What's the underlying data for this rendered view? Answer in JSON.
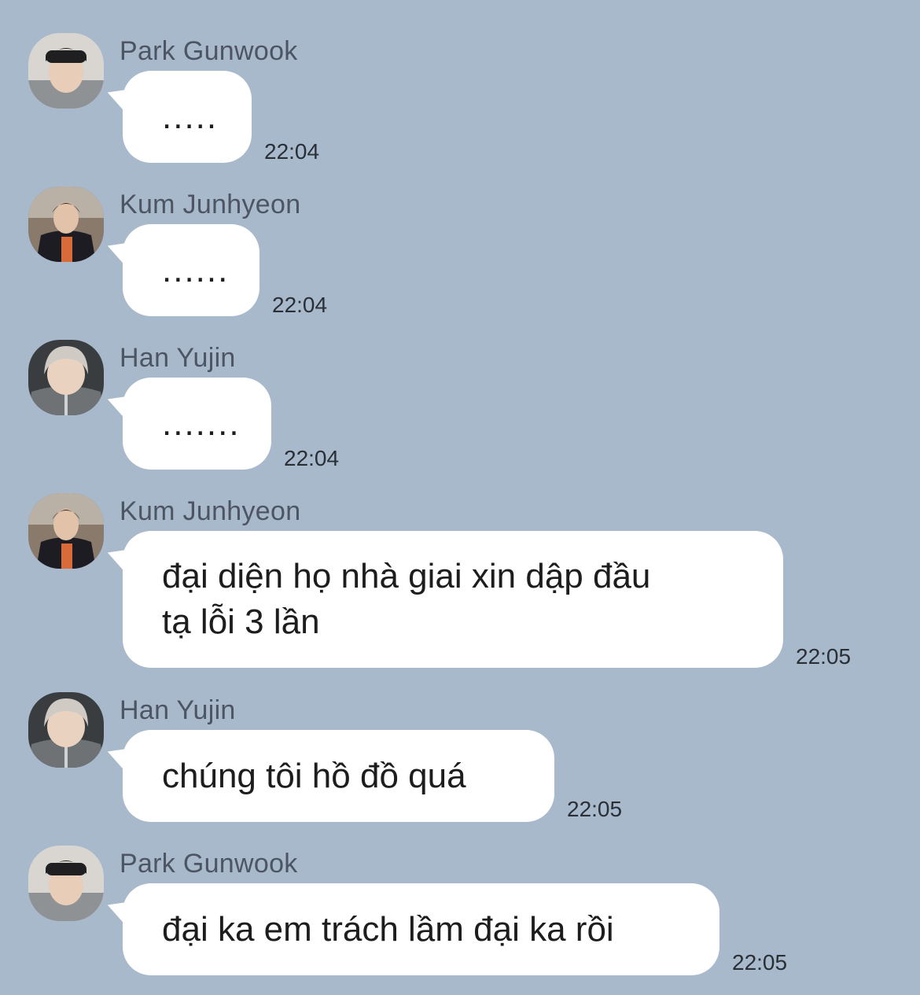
{
  "messages": [
    {
      "sender": "Park Gunwook",
      "text": ".....",
      "time": "22:04",
      "avatar": "park-gunwook"
    },
    {
      "sender": "Kum Junhyeon",
      "text": "......",
      "time": "22:04",
      "avatar": "kum-junhyeon"
    },
    {
      "sender": "Han Yujin",
      "text": ".......",
      "time": "22:04",
      "avatar": "han-yujin"
    },
    {
      "sender": "Kum Junhyeon",
      "lines": [
        "đại diện họ nhà giai xin dập đầu",
        "tạ lỗi 3 lần"
      ],
      "time": "22:05",
      "avatar": "kum-junhyeon"
    },
    {
      "sender": "Han Yujin",
      "text": "chúng tôi hồ đồ quá",
      "time": "22:05",
      "avatar": "han-yujin"
    },
    {
      "sender": "Park Gunwook",
      "text": "đại ka em trách lầm đại ka rồi",
      "time": "22:05",
      "avatar": "park-gunwook"
    }
  ],
  "colors": {
    "background": "#a8b9cc",
    "bubble": "#ffffff",
    "name": "#4d5563"
  }
}
